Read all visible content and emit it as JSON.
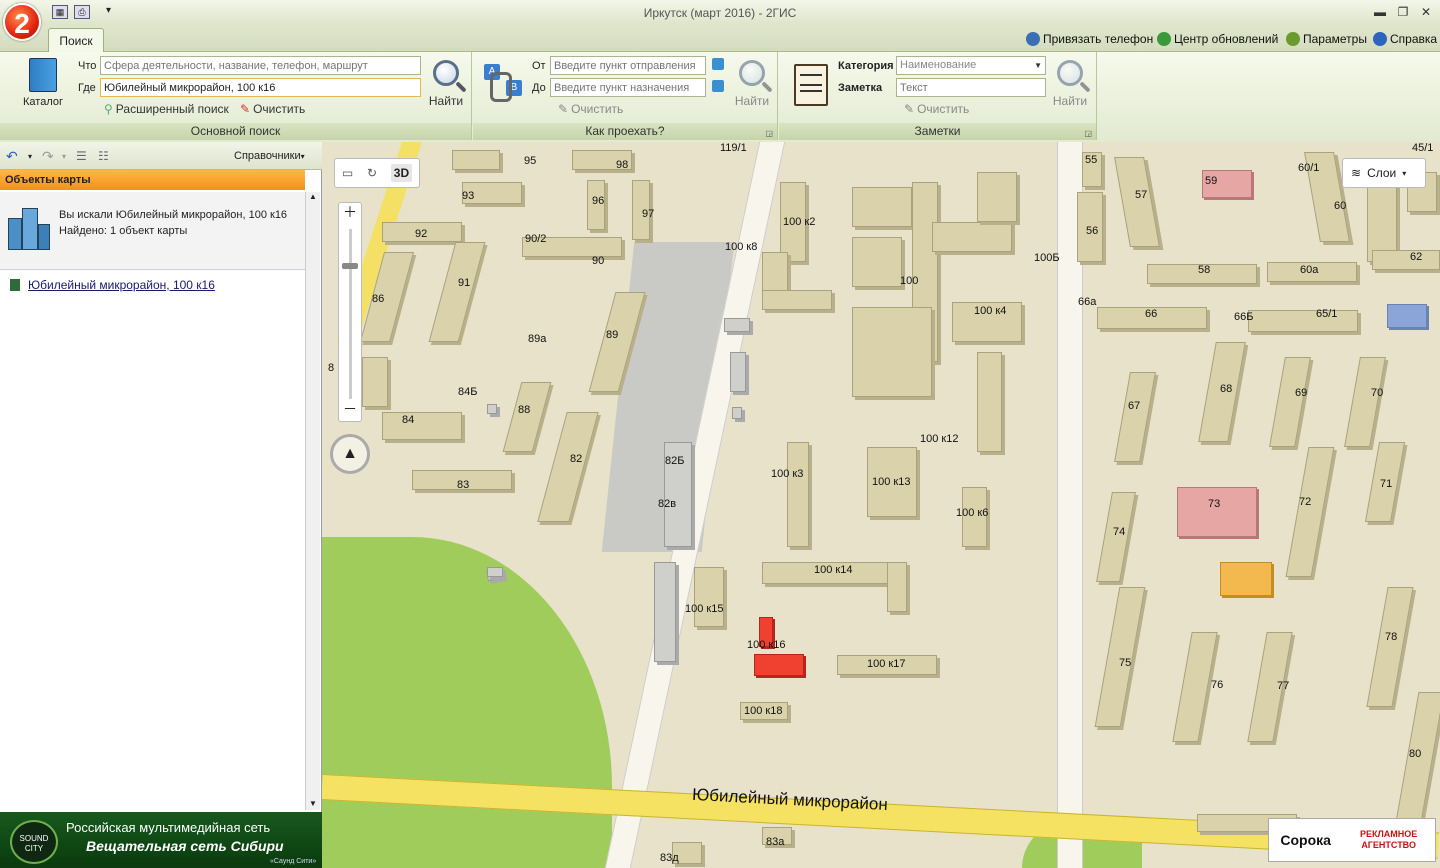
{
  "window": {
    "title": "Иркутск (март 2016) - 2ГИС",
    "logo_text": "2",
    "min_glyph": "▬",
    "max_glyph": "❐",
    "close_glyph": "✕"
  },
  "tabs": {
    "search": "Поиск"
  },
  "top_links": {
    "bind_phone": "Привязать телефон",
    "update_center": "Центр обновлений",
    "settings": "Параметры",
    "help": "Справка"
  },
  "main_search": {
    "catalog_label": "Каталог",
    "what_label": "Что",
    "where_label": "Где",
    "what_placeholder": "Сфера деятельности, название, телефон, маршрут",
    "where_value": "Юбилейный микрорайон, 100 к16",
    "find_label": "Найти",
    "advanced_search": "Расширенный поиск",
    "clear": "Очистить",
    "group_label": "Основной поиск"
  },
  "route": {
    "from_label": "От",
    "to_label": "До",
    "from_placeholder": "Введите пункт отправления",
    "to_placeholder": "Введите пункт назначения",
    "find_label": "Найти",
    "clear": "Очистить",
    "group_label": "Как проехать?"
  },
  "notes": {
    "category_label": "Категория",
    "note_label": "Заметка",
    "category_value": "Наименование",
    "text_placeholder": "Текст",
    "find_label": "Найти",
    "clear": "Очистить",
    "group_label": "Заметки"
  },
  "left_panel": {
    "directories": "Справочники",
    "objects_header": "Объекты карты",
    "searched_text": "Вы искали Юбилейный микрорайон, 100 к16",
    "found_text": "Найдено: 1 объект карты",
    "result_item": "Юбилейный микрорайон, 100 к16"
  },
  "banner": {
    "line1": "Российская мультимедийная сеть",
    "line2": "Вещательная сеть Сибири",
    "small": "«Саунд Сити»",
    "logo": "SOUND CITY"
  },
  "map": {
    "layers_label": "Слои",
    "mode_3d": "3D",
    "street_label": "Юбилейный микрорайон",
    "ad_brand": "Сорока",
    "ad_text": "РЕКЛАМНОЕ АГЕНТСТВО",
    "labels": {
      "l95": "95",
      "l98": "98",
      "l119": "119/1",
      "l93": "93",
      "l96": "96",
      "l97": "97",
      "l92": "92",
      "l90_2": "90/2",
      "l90": "90",
      "l91": "91",
      "l86": "86",
      "l89a": "89а",
      "l89": "89",
      "l84b": "84Б",
      "l88": "88",
      "l84": "84",
      "l82": "82",
      "l83": "83",
      "l100k2": "100 к2",
      "l100k8": "100 к8",
      "l100": "100",
      "l100b": "100Б",
      "l100k4": "100 к4",
      "l82b": "82Б",
      "l82v": "82в",
      "l100k3": "100 к3",
      "l100k13": "100 к13",
      "l100k12": "100 к12",
      "l100k6": "100 к6",
      "l100k14": "100 к14",
      "l100k15": "100 к15",
      "l100k16": "100 к16",
      "l100k17": "100 к17",
      "l100k18": "100 к18",
      "l55": "55",
      "l57": "57",
      "l56": "56",
      "l59": "59",
      "l60_1": "60/1",
      "l60": "60",
      "l62": "62",
      "l58": "58",
      "l60a": "60а",
      "l66a": "66а",
      "l66": "66",
      "l66b": "66Б",
      "l65_1": "65/1",
      "l67": "67",
      "l68": "68",
      "l69": "69",
      "l70": "70",
      "l73": "73",
      "l72": "72",
      "l71": "71",
      "l74": "74",
      "l75": "75",
      "l76": "76",
      "l77": "77",
      "l78": "78",
      "l80": "80",
      "l83a": "83а",
      "l83d": "83д",
      "l8": "8",
      "l45_1": "45/1"
    }
  }
}
